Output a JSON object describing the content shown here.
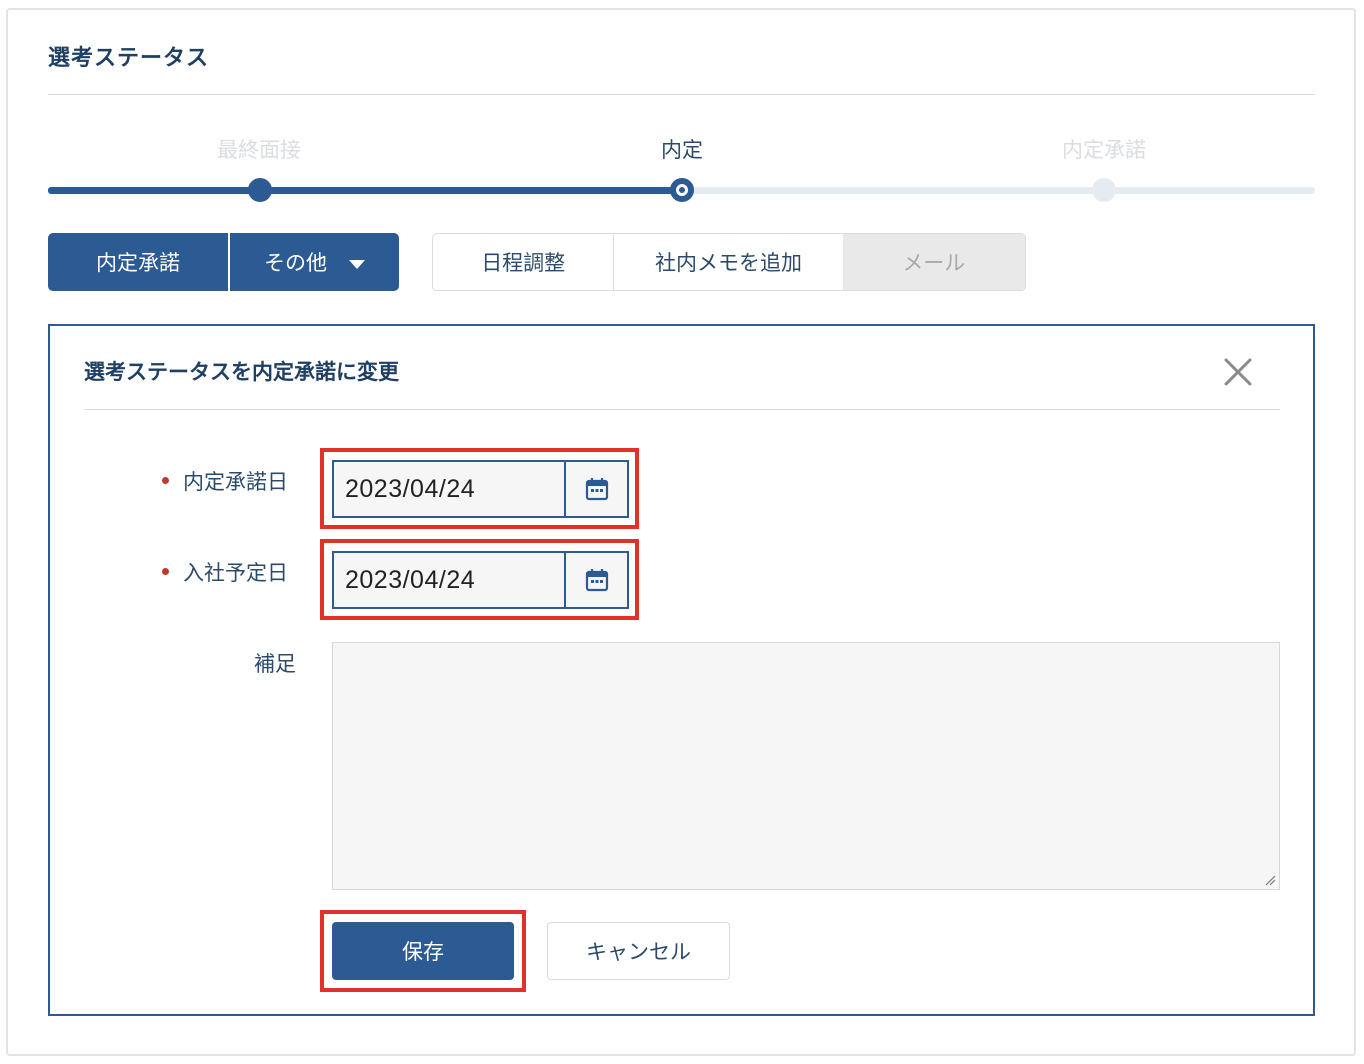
{
  "section": {
    "title": "選考ステータス"
  },
  "stepper": {
    "steps": [
      {
        "label": "最終面接",
        "state": "done"
      },
      {
        "label": "内定",
        "state": "current"
      },
      {
        "label": "内定承諾",
        "state": "todo"
      }
    ]
  },
  "actions": {
    "primary": {
      "accept_label": "内定承諾",
      "other_label": "その他"
    },
    "secondary": {
      "schedule_label": "日程調整",
      "memo_label": "社内メモを追加",
      "mail_label": "メール"
    }
  },
  "panel": {
    "title": "選考ステータスを内定承諾に変更",
    "close_icon": "close-icon",
    "fields": {
      "accept_date": {
        "label": "内定承諾日",
        "value": "2023/04/24",
        "required": true
      },
      "join_date": {
        "label": "入社予定日",
        "value": "2023/04/24",
        "required": true
      },
      "note": {
        "label": "補足",
        "value": ""
      }
    },
    "buttons": {
      "save_label": "保存",
      "cancel_label": "キャンセル"
    }
  },
  "colors": {
    "primary": "#2c5a93",
    "title": "#1f3f63",
    "highlight": "#e0312b",
    "required": "#c0392b"
  }
}
